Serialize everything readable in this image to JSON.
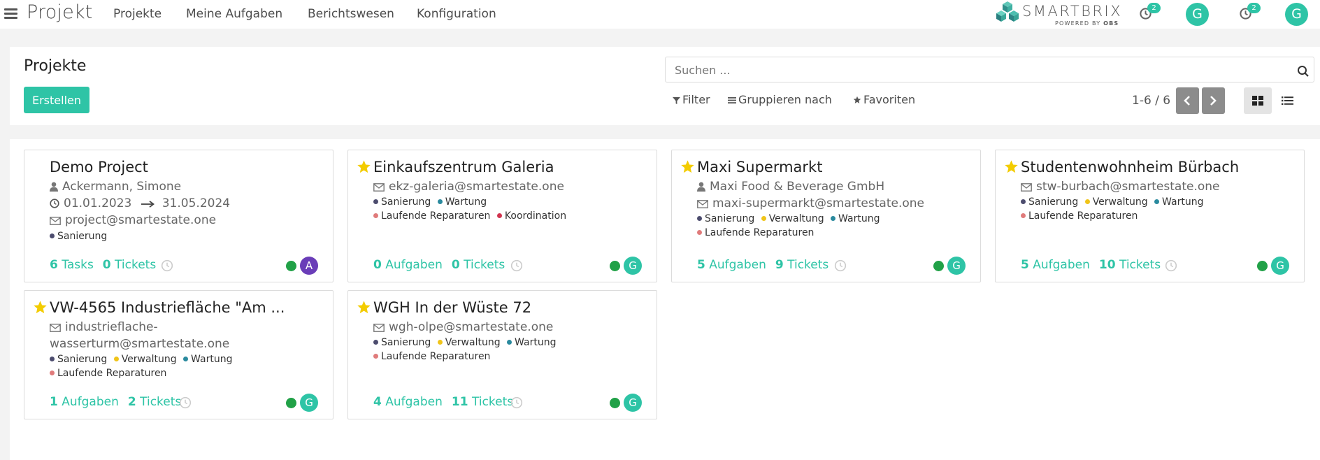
{
  "navbar": {
    "app_title": "Projekt",
    "menu": [
      "Projekte",
      "Meine Aufgaben",
      "Berichtswesen",
      "Konfiguration"
    ],
    "brand": {
      "name": "SMARTBRIX",
      "powered_by": "POWERED BY",
      "powered_company": "OBS"
    },
    "activity_badge_1": "2",
    "activity_badge_2": "2",
    "avatar_1": "G",
    "avatar_2": "G"
  },
  "control_panel": {
    "title": "Projekte",
    "create_label": "Erstellen",
    "search_placeholder": "Suchen ...",
    "filter_label": "Filter",
    "group_label": "Gruppieren nach",
    "favorites_label": "Favoriten",
    "pager_value": "1-6 / 6"
  },
  "colors": {
    "accent": "#2ec4a6",
    "star": "#f3cc00",
    "status_green": "#21a147",
    "tag_sanierung": "#4c4c6e",
    "tag_wartung": "#2a8a9e",
    "tag_laufende": "#e07b7b",
    "tag_koordination": "#d1344f",
    "tag_verwaltung": "#f0c419",
    "avatar_a": "#6a3db8"
  },
  "cards": [
    {
      "title": "Demo Project",
      "starred": false,
      "contact": "Ackermann, Simone",
      "date_start": "01.01.2023",
      "date_end": "31.05.2024",
      "email": "project@smartestate.one",
      "tags": [
        {
          "label": "Sanierung",
          "color": "#4c4c6e"
        }
      ],
      "footer_count_1": "6",
      "footer_label_1": "Tasks",
      "footer_count_2": "0",
      "footer_label_2": "Tickets",
      "avatar": "A"
    },
    {
      "title": "Einkaufszentrum Galeria",
      "starred": true,
      "email": "ekz-galeria@smartestate.one",
      "tags": [
        {
          "label": "Sanierung",
          "color": "#4c4c6e"
        },
        {
          "label": "Wartung",
          "color": "#2a8a9e"
        },
        {
          "label": "Laufende Reparaturen",
          "color": "#e07b7b"
        },
        {
          "label": "Koordination",
          "color": "#d1344f"
        }
      ],
      "footer_count_1": "0",
      "footer_label_1": "Aufgaben",
      "footer_count_2": "0",
      "footer_label_2": "Tickets",
      "avatar": "G"
    },
    {
      "title": "Maxi Supermarkt",
      "starred": true,
      "contact": "Maxi Food & Beverage GmbH",
      "email": "maxi-supermarkt@smartestate.one",
      "tags": [
        {
          "label": "Sanierung",
          "color": "#4c4c6e"
        },
        {
          "label": "Verwaltung",
          "color": "#f0c419"
        },
        {
          "label": "Wartung",
          "color": "#2a8a9e"
        },
        {
          "label": "Laufende Reparaturen",
          "color": "#e07b7b"
        }
      ],
      "footer_count_1": "5",
      "footer_label_1": "Aufgaben",
      "footer_count_2": "9",
      "footer_label_2": "Tickets",
      "avatar": "G"
    },
    {
      "title": "Studentenwohnheim Bürbach",
      "starred": true,
      "email": "stw-burbach@smartestate.one",
      "tags": [
        {
          "label": "Sanierung",
          "color": "#4c4c6e"
        },
        {
          "label": "Verwaltung",
          "color": "#f0c419"
        },
        {
          "label": "Wartung",
          "color": "#2a8a9e"
        },
        {
          "label": "Laufende Reparaturen",
          "color": "#e07b7b"
        }
      ],
      "footer_count_1": "5",
      "footer_label_1": "Aufgaben",
      "footer_count_2": "10",
      "footer_label_2": "Tickets",
      "avatar": "G"
    },
    {
      "title": "VW-4565 Industriefläche \"Am ...",
      "starred": true,
      "email_line_1": "industrieflache-",
      "email_line_2": "wasserturm@smartestate.one",
      "tags": [
        {
          "label": "Sanierung",
          "color": "#4c4c6e"
        },
        {
          "label": "Verwaltung",
          "color": "#f0c419"
        },
        {
          "label": "Wartung",
          "color": "#2a8a9e"
        },
        {
          "label": "Laufende Reparaturen",
          "color": "#e07b7b"
        }
      ],
      "footer_count_1": "1",
      "footer_label_1": "Aufgaben",
      "footer_count_2": "2",
      "footer_label_2": "Tickets",
      "avatar": "G"
    },
    {
      "title": "WGH In der Wüste 72",
      "starred": true,
      "email": "wgh-olpe@smartestate.one",
      "tags": [
        {
          "label": "Sanierung",
          "color": "#4c4c6e"
        },
        {
          "label": "Verwaltung",
          "color": "#f0c419"
        },
        {
          "label": "Wartung",
          "color": "#2a8a9e"
        },
        {
          "label": "Laufende Reparaturen",
          "color": "#e07b7b"
        }
      ],
      "footer_count_1": "4",
      "footer_label_1": "Aufgaben",
      "footer_count_2": "11",
      "footer_label_2": "Tickets",
      "avatar": "G"
    }
  ]
}
